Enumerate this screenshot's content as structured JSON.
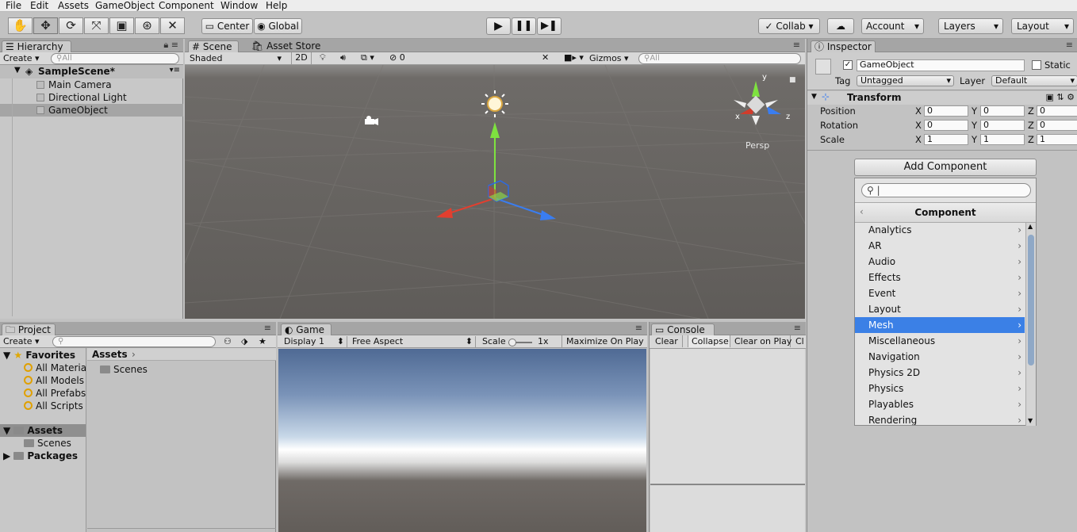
{
  "menu": [
    "File",
    "Edit",
    "Assets",
    "GameObject",
    "Component",
    "Window",
    "Help"
  ],
  "toolbar": {
    "tools": [
      "hand-icon",
      "move-icon",
      "rotate-icon",
      "scale-icon",
      "rect-icon",
      "transform-icon",
      "custom-tool-icon"
    ],
    "pivot_label": "Center",
    "space_label": "Global",
    "collab_label": "Collab",
    "account_label": "Account",
    "layers_label": "Layers",
    "layout_label": "Layout"
  },
  "hierarchy": {
    "tab": "Hierarchy",
    "create": "Create",
    "search_placeholder": "All",
    "scene": "SampleScene*",
    "items": [
      "Main Camera",
      "Directional Light",
      "GameObject"
    ]
  },
  "scene": {
    "tab_scene": "Scene",
    "tab_store": "Asset Store",
    "shading": "Shaded",
    "mode_2d": "2D",
    "hidden_count": "0",
    "gizmos": "Gizmos",
    "search_placeholder": "All",
    "persp": "Persp",
    "axis_x": "x",
    "axis_y": "y",
    "axis_z": "z"
  },
  "inspector": {
    "tab": "Inspector",
    "object_name": "GameObject",
    "static_label": "Static",
    "tag_label": "Tag",
    "tag_value": "Untagged",
    "layer_label": "Layer",
    "layer_value": "Default",
    "transform_label": "Transform",
    "rows": [
      {
        "label": "Position",
        "x": "0",
        "y": "0",
        "z": "0"
      },
      {
        "label": "Rotation",
        "x": "0",
        "y": "0",
        "z": "0"
      },
      {
        "label": "Scale",
        "x": "1",
        "y": "1",
        "z": "1"
      }
    ],
    "axis_x": "X",
    "axis_y": "Y",
    "axis_z": "Z",
    "add_component": "Add Component",
    "component_header": "Component",
    "components": [
      "Analytics",
      "AR",
      "Audio",
      "Effects",
      "Event",
      "Layout",
      "Mesh",
      "Miscellaneous",
      "Navigation",
      "Physics 2D",
      "Physics",
      "Playables",
      "Rendering"
    ],
    "selected_component": "Mesh"
  },
  "project": {
    "tab": "Project",
    "create": "Create",
    "favorites": "Favorites",
    "fav_items": [
      "All Materia",
      "All Models",
      "All Prefabs",
      "All Scripts"
    ],
    "assets": "Assets",
    "scenes": "Scenes",
    "packages": "Packages",
    "breadcrumb": "Assets",
    "folder_scenes": "Scenes"
  },
  "game": {
    "tab": "Game",
    "display": "Display 1",
    "aspect": "Free Aspect",
    "scale_label": "Scale",
    "scale_value": "1x",
    "maximize": "Maximize On Play"
  },
  "console": {
    "tab": "Console",
    "clear": "Clear",
    "collapse": "Collapse",
    "clear_on_play": "Clear on Play",
    "cut": "Cl"
  }
}
